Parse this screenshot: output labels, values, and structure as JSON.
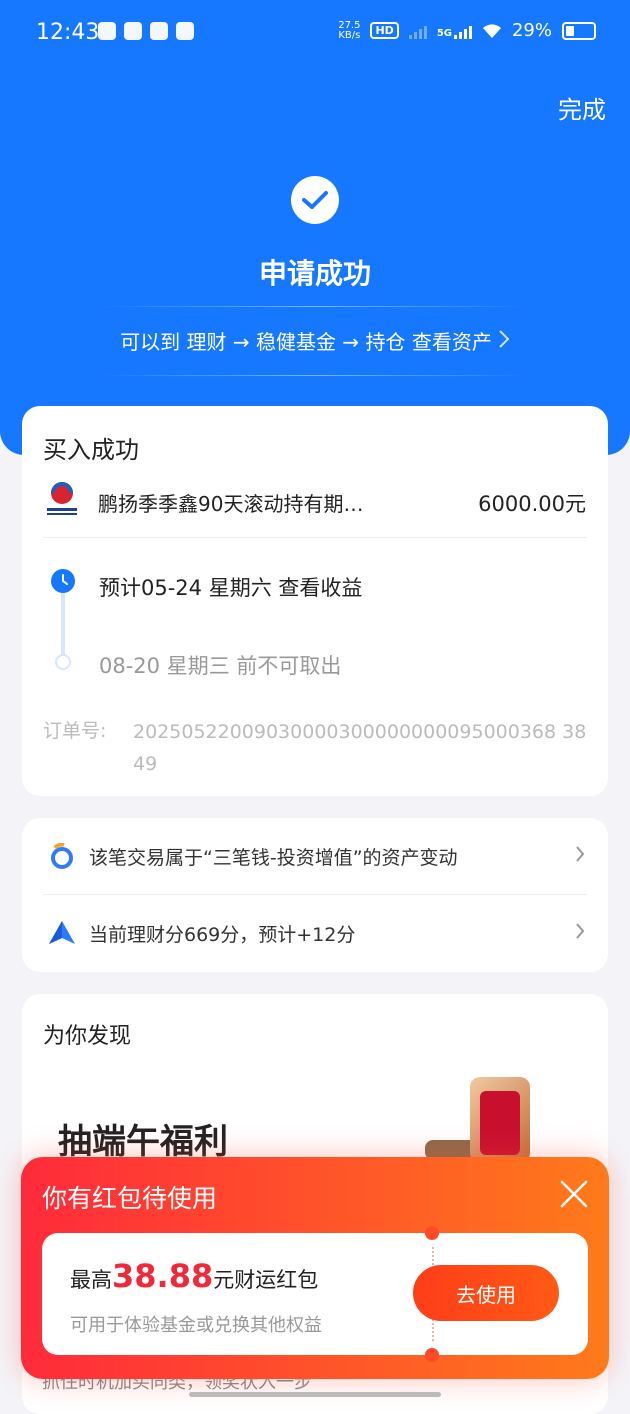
{
  "status_bar": {
    "time": "12:43",
    "net_speed_value": "27.5",
    "net_speed_unit": "KB/s",
    "hd_badge": "HD",
    "network": "5G",
    "battery": "29%"
  },
  "header": {
    "done_label": "完成",
    "title": "申请成功",
    "guide_text": "可以到 理财 → 稳健基金 → 持仓 查看资产",
    "accent_color": "#1677ff"
  },
  "purchase": {
    "section_title": "买入成功",
    "fund_name": "鹏扬季季鑫90天滚动持有期…",
    "amount": "6000.00元",
    "logo_text": "鹏扬基金",
    "timeline": {
      "step1": "预计05-24 星期六 查看收益",
      "step2": "08-20 星期三 前不可取出"
    },
    "order_label": "订单号:",
    "order_no": "20250522009030000300000000095000368 3849"
  },
  "info_rows": [
    {
      "text": "该笔交易属于“三笔钱-投资增值”的资产变动",
      "icon": "gold-coin-icon"
    },
    {
      "text": "当前理财分669分，预计+12分",
      "icon": "blue-triangle-icon"
    }
  ],
  "discover": {
    "section_title": "为你发现",
    "banner_text": "抽端午福利"
  },
  "popup": {
    "title": "你有红包待使用",
    "prefix": "最高",
    "amount": "38.88",
    "suffix": "元财运红包",
    "subtext": "可用于体验基金或兑换其他权益",
    "button": "去使用",
    "tail_text": "抓住时机加买同类，领奖状入一步"
  }
}
